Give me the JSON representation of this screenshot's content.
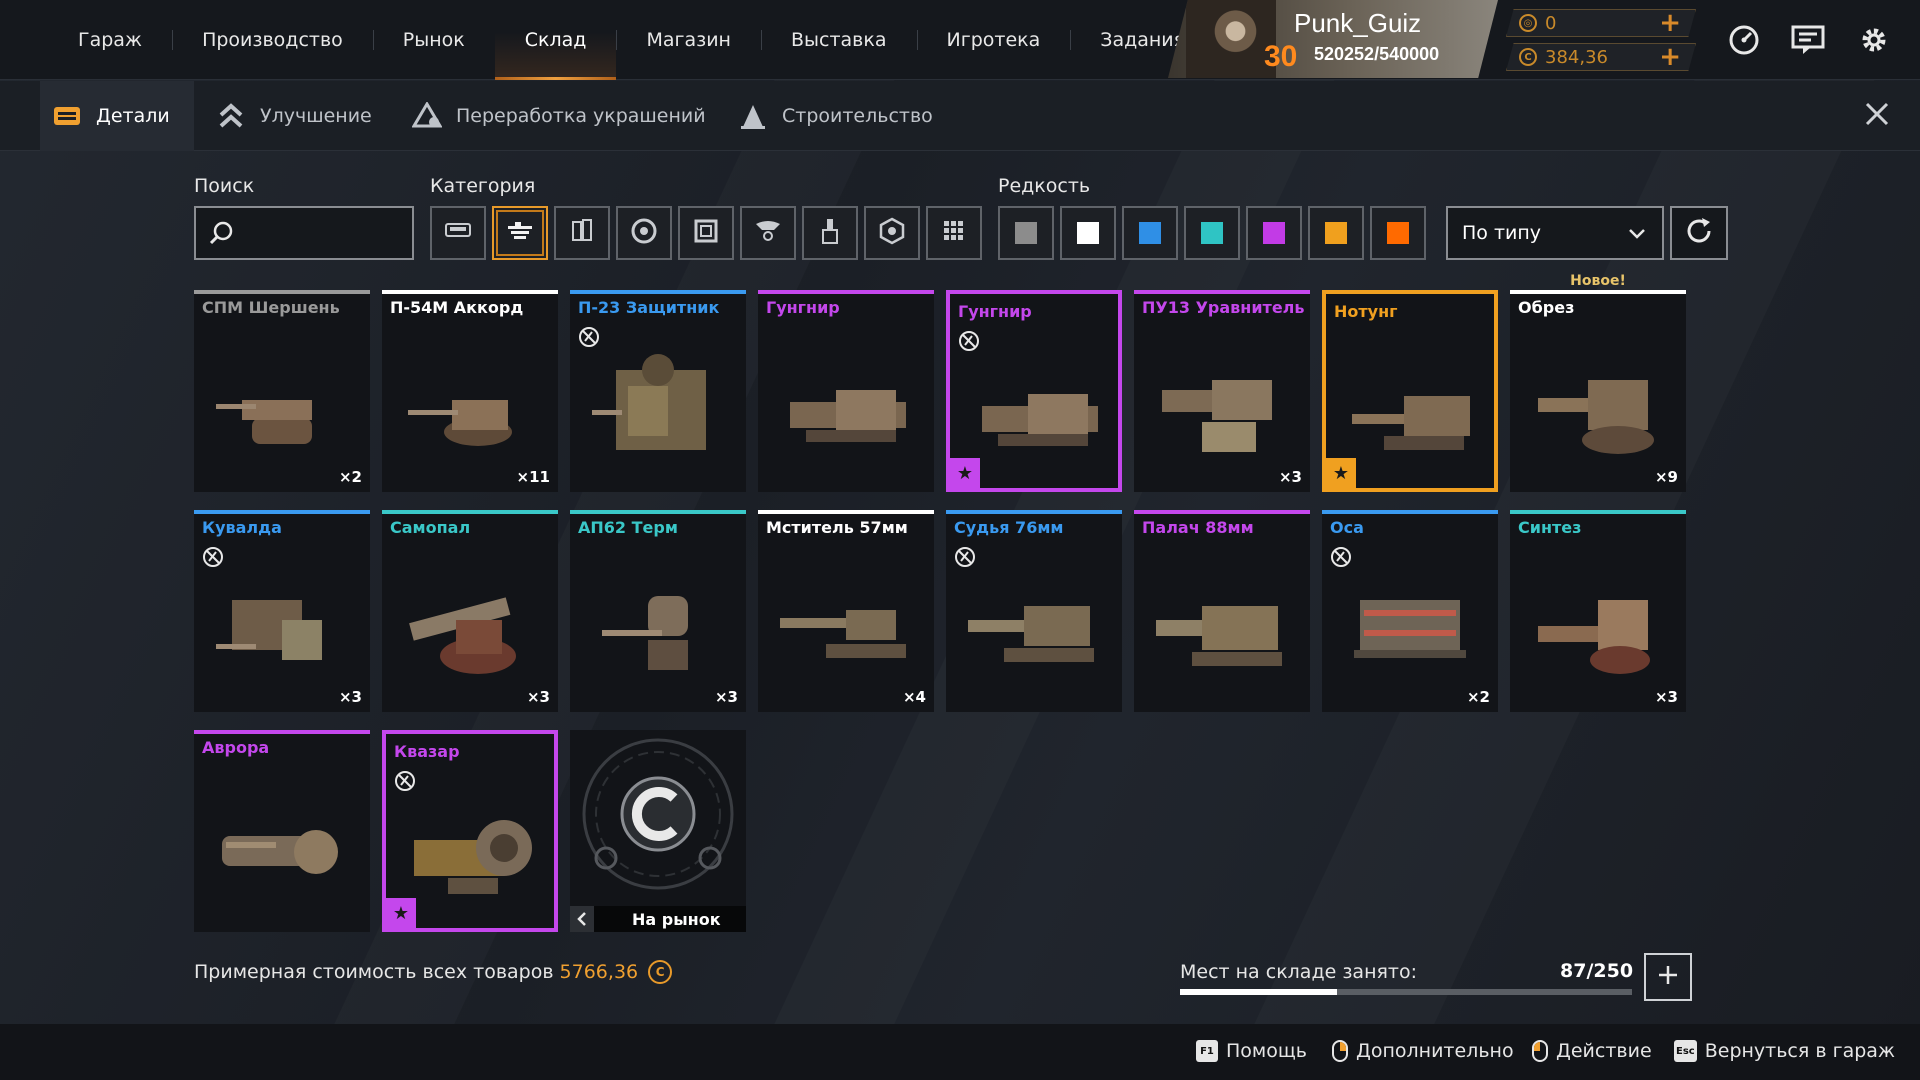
{
  "topnav": {
    "items": [
      {
        "label": "Гараж",
        "active": false
      },
      {
        "label": "Производство",
        "active": false
      },
      {
        "label": "Рынок",
        "active": false
      },
      {
        "label": "Склад",
        "active": true
      },
      {
        "label": "Магазин",
        "active": false
      },
      {
        "label": "Выставка",
        "active": false
      },
      {
        "label": "Игротека",
        "active": false
      },
      {
        "label": "Задания",
        "active": false
      }
    ]
  },
  "profile": {
    "username": "Punk_Guiz",
    "level": "30",
    "xp": "520252/540000"
  },
  "currency": {
    "primary": "0",
    "secondary": "384,36"
  },
  "top_icons": [
    "speedometer-icon",
    "messages-icon",
    "settings-icon"
  ],
  "subtabs": [
    {
      "label": "Детали",
      "icon": "crate-icon",
      "active": true
    },
    {
      "label": "Улучшение",
      "icon": "upgrade-chevrons-icon",
      "active": false
    },
    {
      "label": "Переработка украшений",
      "icon": "recycle-icon",
      "active": false
    },
    {
      "label": "Строительство",
      "icon": "construction-icon",
      "active": false
    }
  ],
  "filters": {
    "search_label": "Поиск",
    "search_value": "",
    "category_label": "Категория",
    "categories": [
      "cabin-icon",
      "weapon-icon",
      "module-icon",
      "wheel-icon",
      "frame-icon",
      "decor-icon",
      "paint-brush-icon",
      "resource-icon",
      "grid-icon"
    ],
    "active_category": 1,
    "rarity_label": "Редкость",
    "rarity_colors": [
      "#8c8c8c",
      "#ffffff",
      "#2f8fe6",
      "#2fc4c4",
      "#c23be6",
      "#f0a01e",
      "#ff6a00"
    ],
    "sort_value": "По типу"
  },
  "colors": {
    "common": "#9a9a9a",
    "uncommon": "#ffffff",
    "rare": "#3a9af0",
    "special": "#3ac8c8",
    "epic": "#c447ec",
    "legendary": "#f0a020",
    "accent": "#e89a2a"
  },
  "items": [
    {
      "name": "СПМ Шершень",
      "rarity": "common",
      "count": "×2",
      "no_craft": false,
      "starred": false,
      "bordered": false,
      "badge": ""
    },
    {
      "name": "П-54М Аккорд",
      "rarity": "uncommon",
      "count": "×11",
      "no_craft": false,
      "starred": false,
      "bordered": false,
      "badge": ""
    },
    {
      "name": "П-23 Защитник",
      "rarity": "rare",
      "count": "",
      "no_craft": true,
      "starred": false,
      "bordered": false,
      "badge": ""
    },
    {
      "name": "Гунгнир",
      "rarity": "epic",
      "count": "",
      "no_craft": false,
      "starred": false,
      "bordered": false,
      "badge": ""
    },
    {
      "name": "Гунгнир",
      "rarity": "epic",
      "count": "",
      "no_craft": true,
      "starred": true,
      "bordered": true,
      "badge": ""
    },
    {
      "name": "ПУ13 Уравнитель",
      "rarity": "epic",
      "count": "×3",
      "no_craft": false,
      "starred": false,
      "bordered": false,
      "badge": ""
    },
    {
      "name": "Нотунг",
      "rarity": "legendary",
      "count": "",
      "no_craft": false,
      "starred": true,
      "bordered": true,
      "badge": ""
    },
    {
      "name": "Обрез",
      "rarity": "uncommon",
      "count": "×9",
      "no_craft": false,
      "starred": false,
      "bordered": false,
      "badge": "Новое!"
    },
    {
      "name": "Кувалда",
      "rarity": "rare",
      "count": "×3",
      "no_craft": true,
      "starred": false,
      "bordered": false,
      "badge": ""
    },
    {
      "name": "Самопал",
      "rarity": "special",
      "count": "×3",
      "no_craft": false,
      "starred": false,
      "bordered": false,
      "badge": ""
    },
    {
      "name": "АП62 Терм",
      "rarity": "special",
      "count": "×3",
      "no_craft": false,
      "starred": false,
      "bordered": false,
      "badge": ""
    },
    {
      "name": "Мститель 57мм",
      "rarity": "uncommon",
      "count": "×4",
      "no_craft": false,
      "starred": false,
      "bordered": false,
      "badge": ""
    },
    {
      "name": "Судья 76мм",
      "rarity": "rare",
      "count": "",
      "no_craft": true,
      "starred": false,
      "bordered": false,
      "badge": ""
    },
    {
      "name": "Палач 88мм",
      "rarity": "epic",
      "count": "",
      "no_craft": false,
      "starred": false,
      "bordered": false,
      "badge": ""
    },
    {
      "name": "Оса",
      "rarity": "rare",
      "count": "×2",
      "no_craft": true,
      "starred": false,
      "bordered": false,
      "badge": ""
    },
    {
      "name": "Синтез",
      "rarity": "special",
      "count": "×3",
      "no_craft": false,
      "starred": false,
      "bordered": false,
      "badge": ""
    },
    {
      "name": "Аврора",
      "rarity": "epic",
      "count": "",
      "no_craft": false,
      "starred": false,
      "bordered": false,
      "badge": ""
    },
    {
      "name": "Квазар",
      "rarity": "epic",
      "count": "",
      "no_craft": true,
      "starred": true,
      "bordered": true,
      "badge": ""
    }
  ],
  "market_card": {
    "label": "На рынок"
  },
  "summary": {
    "estimate_label": "Примерная стоимость всех товаров",
    "estimate_value": "5766,36"
  },
  "storage": {
    "label": "Мест на складе занято:",
    "value": "87/250",
    "used": 87,
    "capacity": 250
  },
  "footer": {
    "help": {
      "key": "F1",
      "label": "Помощь"
    },
    "more": {
      "label": "Дополнительно"
    },
    "action": {
      "label": "Действие"
    },
    "back": {
      "key": "Esc",
      "label": "Вернуться в гараж"
    }
  }
}
